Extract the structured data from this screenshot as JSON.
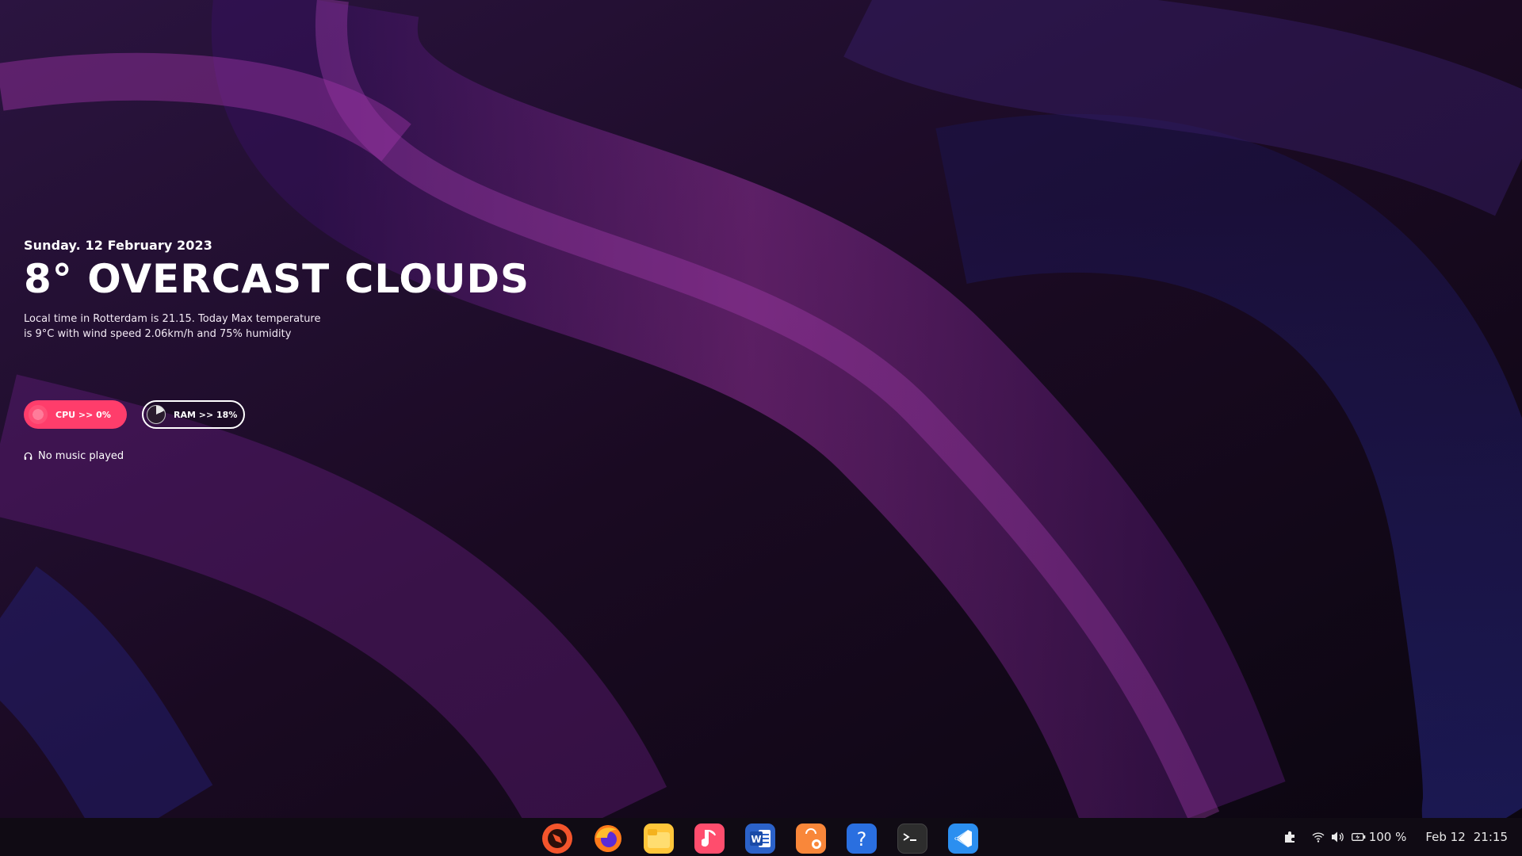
{
  "widget": {
    "date": "Sunday. 12 February 2023",
    "weather": "8° OVERCAST CLOUDS",
    "description": "Local time in Rotterdam  is 21.15. Today Max temperature is 9°C with wind speed 2.06km/h and 75% humidity",
    "cpu_label": "CPU >> 0%",
    "ram_label": "RAM >> 18%",
    "music_status": "No music played",
    "cpu_color": "#ff3d6b"
  },
  "dock": {
    "apps": [
      {
        "name": "system-app-icon",
        "color": "#f4552c"
      },
      {
        "name": "firefox-icon",
        "color": "#ff7a1a"
      },
      {
        "name": "files-icon",
        "color": "#ffc63a"
      },
      {
        "name": "music-app-icon",
        "color": "#ff4d6d"
      },
      {
        "name": "word-icon",
        "color": "#2b62c9"
      },
      {
        "name": "software-store-icon",
        "color": "#f9873a"
      },
      {
        "name": "help-icon",
        "color": "#2a6fe0"
      },
      {
        "name": "terminal-icon",
        "color": "#2d2d2d"
      },
      {
        "name": "vscode-icon",
        "color": "#2b8ff0"
      }
    ]
  },
  "tray": {
    "battery": "100 %",
    "date": "Feb 12",
    "time": "21:15"
  }
}
